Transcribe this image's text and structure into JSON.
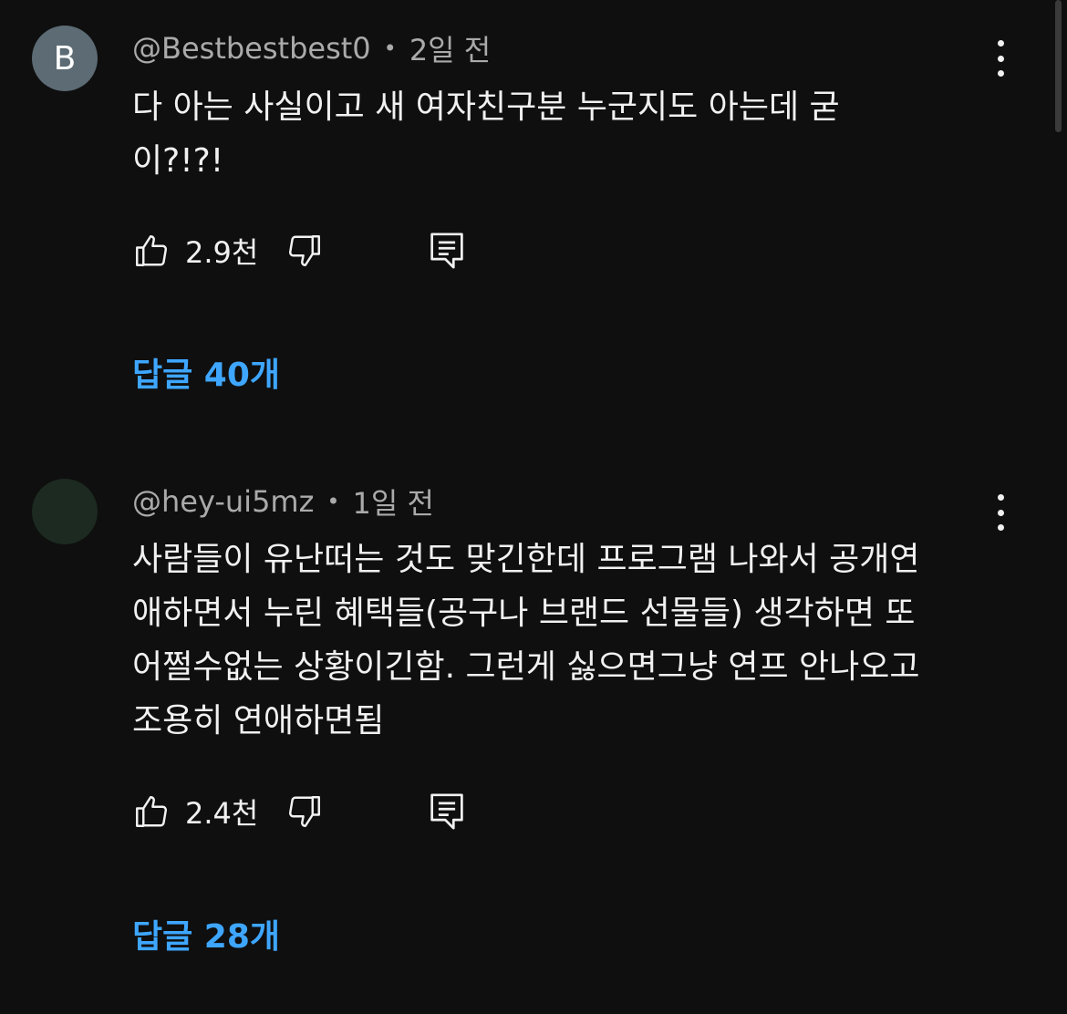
{
  "comments": [
    {
      "avatar_letter": "B",
      "avatar_color": "#5c6b74",
      "author": "@Bestbestbest0",
      "separator": "•",
      "time": "2일 전",
      "text_lines": [
        "다 아는 사실이고 새 여자친구분 누군지도 아는데 굳",
        "이?!?!"
      ],
      "likes": "2.9천",
      "replies": "답글 40개"
    },
    {
      "avatar_letter": "",
      "avatar_color": "#1c2a21",
      "author": "@hey-ui5mz",
      "separator": "•",
      "time": "1일 전",
      "text_lines": [
        "사람들이 유난떠는 것도 맞긴한데 프로그램 나와서 공개연",
        "애하면서 누린 혜택들(공구나 브랜드 선물들) 생각하면 또",
        "어쩔수없는 상황이긴함. 그런게 싫으면그냥 연프 안나오고",
        "조용히 연애하면됨"
      ],
      "likes": "2.4천",
      "replies": "답글 28개"
    }
  ],
  "icons": {
    "like": "thumbs-up-icon",
    "dislike": "thumbs-down-icon",
    "reply": "comment-reply-icon",
    "more": "more-vertical-icon"
  },
  "colors": {
    "background": "#0f0f0f",
    "text": "#f1f1f1",
    "meta": "#aaaaaa",
    "link": "#3ea6ff"
  }
}
